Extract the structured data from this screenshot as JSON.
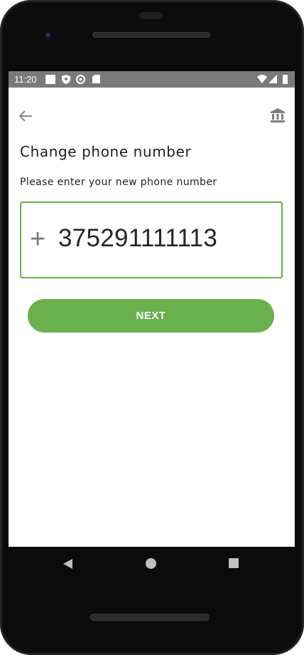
{
  "status_bar": {
    "time": "11:20"
  },
  "header": {
    "back_icon": "arrow-left-icon",
    "bank_icon": "bank-icon"
  },
  "page": {
    "title": "Change phone number",
    "subtitle": "Please enter your new phone number"
  },
  "phone_input": {
    "prefix": "+",
    "value": "375291111113"
  },
  "actions": {
    "next_label": "NEXT"
  },
  "colors": {
    "accent": "#6ab04c",
    "status_bar": "#7a7a7a"
  },
  "nav": {
    "back": "nav-back-icon",
    "home": "nav-home-icon",
    "recents": "nav-recents-icon"
  }
}
